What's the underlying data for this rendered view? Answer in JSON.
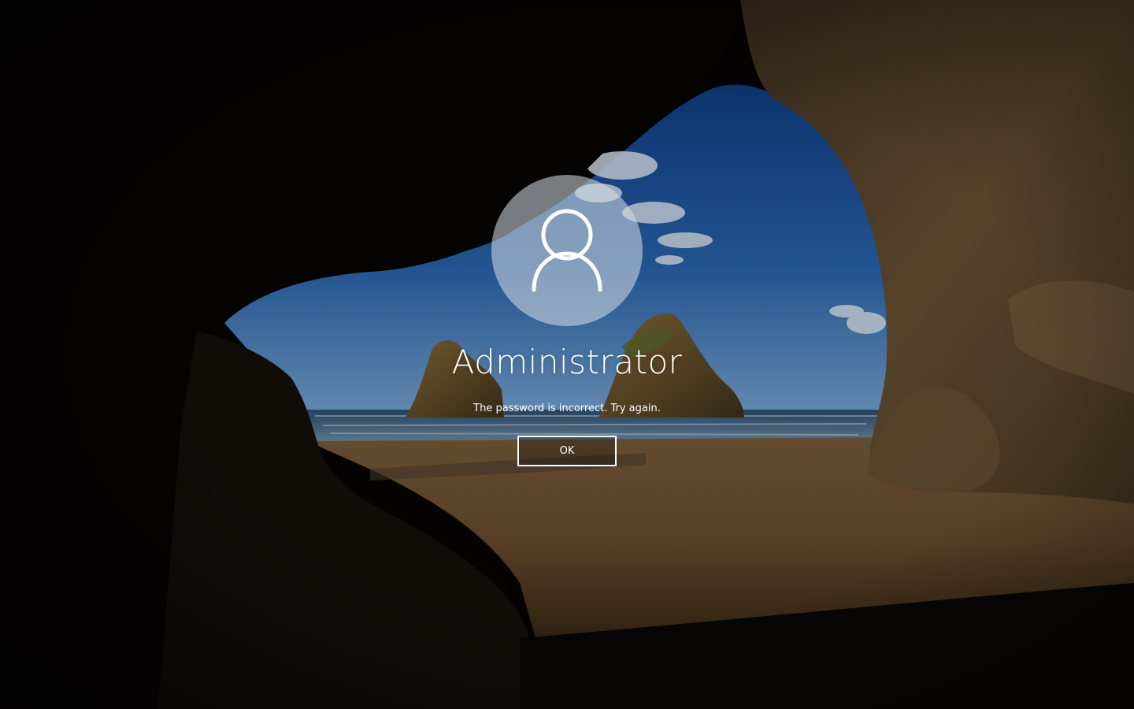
{
  "login": {
    "username": "Administrator",
    "message": "The password is incorrect. Try again.",
    "ok_label": "OK",
    "avatar_icon": "user-icon"
  },
  "colors": {
    "text": "#ffffff",
    "avatar_bg": "rgba(215,222,230,0.55)",
    "button_border": "#ffffff"
  }
}
